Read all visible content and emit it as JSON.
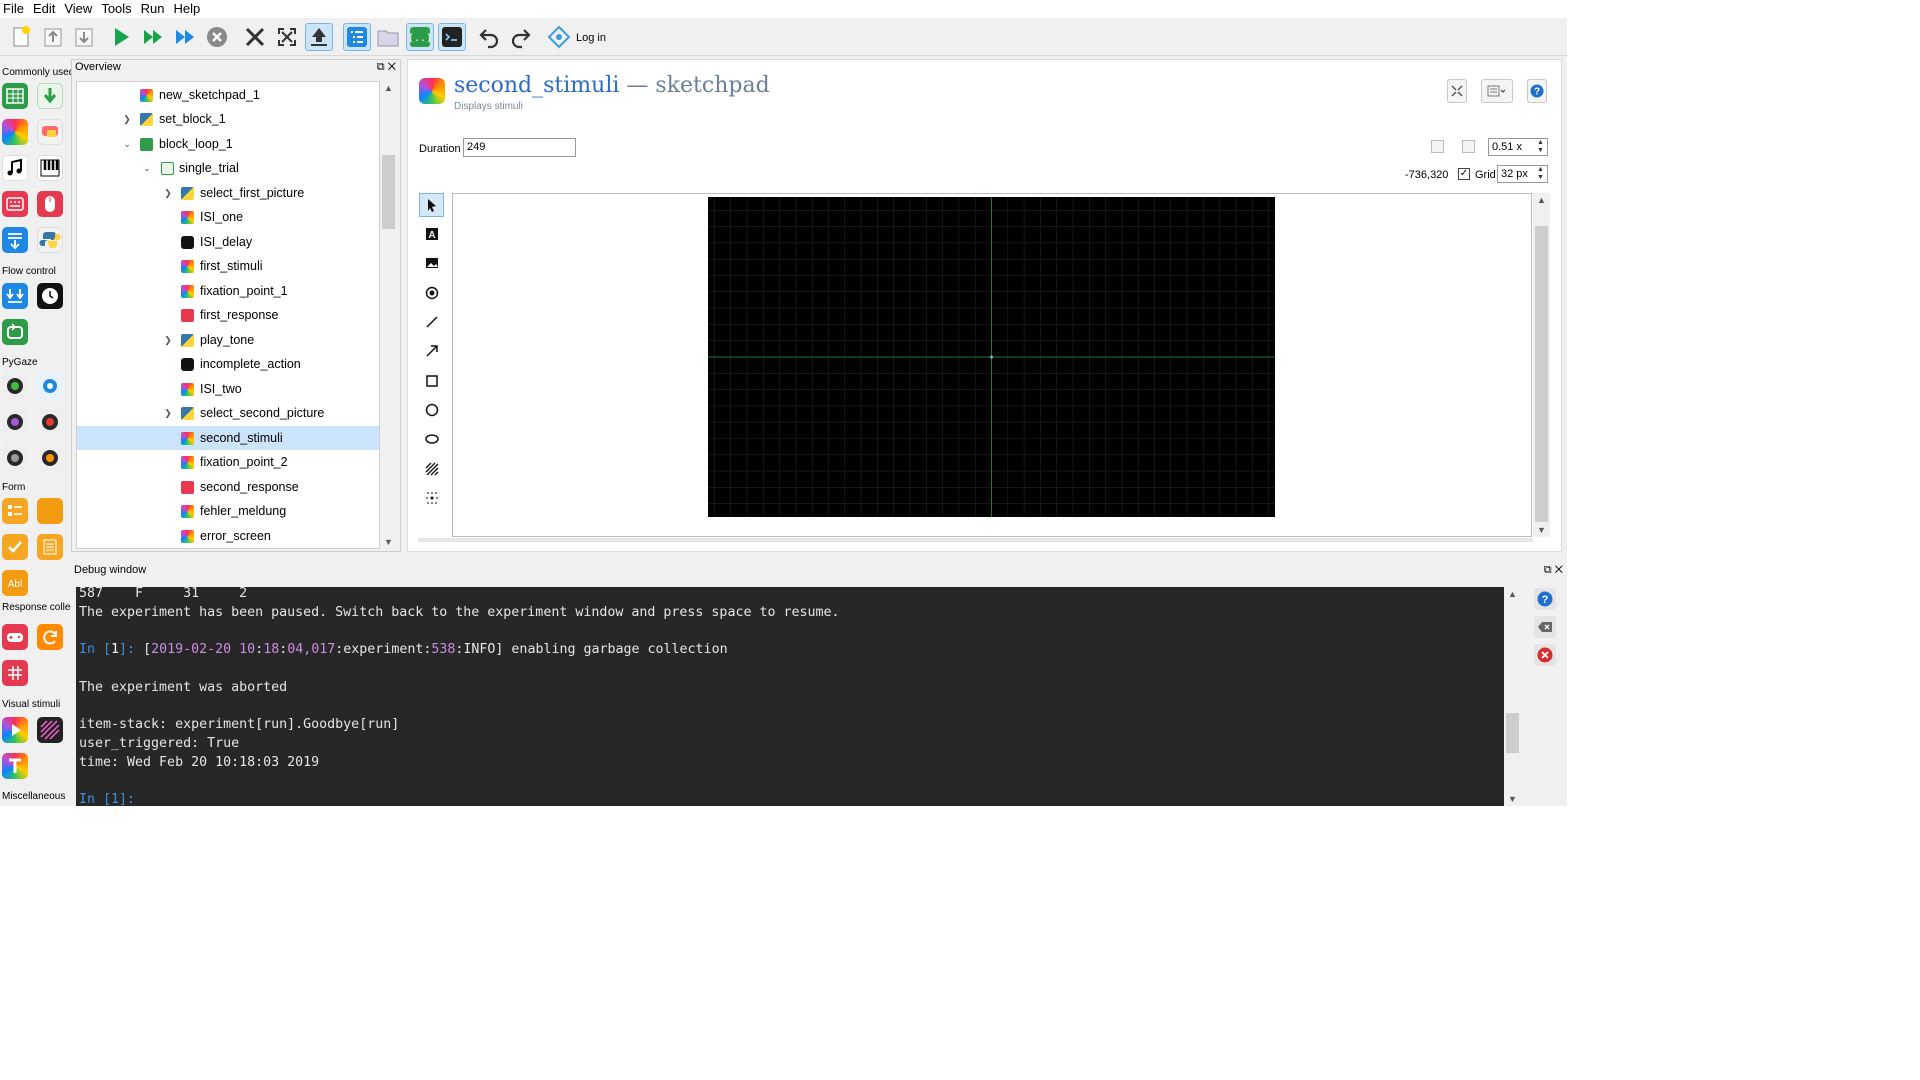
{
  "menu": [
    "File",
    "Edit",
    "View",
    "Tools",
    "Run",
    "Help"
  ],
  "toolbar": {
    "login_label": "Log in",
    "buttons": [
      "new-icon",
      "open-icon",
      "save-icon",
      "run-icon",
      "run-quick-icon",
      "run-in-window-icon",
      "abort-icon",
      "close-all-tabs-icon",
      "fullscreen-icon",
      "one-tab-mode-icon",
      "overview-icon",
      "file-pool-icon",
      "variable-inspector-icon",
      "debug-window-icon",
      "undo-icon",
      "redo-icon",
      "login-icon"
    ]
  },
  "itembar": {
    "categories": [
      "Commonly used",
      "Flow control",
      "PyGaze",
      "Form",
      "Response collection",
      "Visual stimuli",
      "Miscellaneous"
    ]
  },
  "overview": {
    "title": "Overview",
    "items": [
      {
        "label": "new_sketchpad_1",
        "icon": "sketchpad"
      },
      {
        "label": "set_block_1",
        "icon": "inline"
      },
      {
        "label": "block_loop_1",
        "icon": "loop"
      },
      {
        "label": "single_trial",
        "icon": "sequence"
      },
      {
        "label": "select_first_picture",
        "icon": "inline"
      },
      {
        "label": "ISI_one",
        "icon": "sketchpad"
      },
      {
        "label": "ISI_delay",
        "icon": "timer"
      },
      {
        "label": "first_stimuli",
        "icon": "sketchpad"
      },
      {
        "label": "fixation_point_1",
        "icon": "sketchpad"
      },
      {
        "label": "first_response",
        "icon": "keyboard"
      },
      {
        "label": "play_tone",
        "icon": "inline"
      },
      {
        "label": "incomplete_action",
        "icon": "timer"
      },
      {
        "label": "ISI_two",
        "icon": "sketchpad"
      },
      {
        "label": "select_second_picture",
        "icon": "inline"
      },
      {
        "label": "second_stimuli",
        "icon": "sketchpad"
      },
      {
        "label": "fixation_point_2",
        "icon": "sketchpad"
      },
      {
        "label": "second_response",
        "icon": "keyboard"
      },
      {
        "label": "fehler_meldung",
        "icon": "sketchpad"
      },
      {
        "label": "error_screen",
        "icon": "sketchpad"
      }
    ],
    "selected": "second_stimuli"
  },
  "editor": {
    "item_name": "second_stimuli",
    "dash": "—",
    "item_type": "sketchpad",
    "subtitle": "Displays stimuli",
    "duration_label": "Duration",
    "duration_value": "249",
    "zoom_value": "0.51 x",
    "cursor_coords": "-736,320",
    "grid_label": "Grid",
    "grid_checked": "✓",
    "grid_value": "32 px",
    "tools": [
      "select-tool-icon",
      "text-tool-icon",
      "image-tool-icon",
      "gabor-tool-icon",
      "line-tool-icon",
      "arrow-tool-icon",
      "rect-tool-icon",
      "circle-tool-icon",
      "ellipse-tool-icon",
      "noise-patch-tool-icon",
      "fixdot-tool-icon"
    ]
  },
  "debug": {
    "title": "Debug window",
    "lines": {
      "l1": "587    F     31     2",
      "l2": "The experiment has been paused. Switch back to the experiment window and press space to resume.",
      "l3_prompt": "In [",
      "l3_num": "1",
      "l3_close": "]: ",
      "l3_open": "[",
      "l3_date": "2019-02-20",
      "l3_time_a": "10",
      "l3_colon1": ":",
      "l3_time_b": "18",
      "l3_colon2": ":",
      "l3_time_c": "04,017",
      "l3_mod": ":experiment:",
      "l3_line": "538",
      "l3_rest": ":INFO] enabling garbage collection",
      "l4": "The experiment was aborted",
      "l5": "item-stack: experiment[run].Goodbye[run]",
      "l6": "user_triggered: True",
      "l7": "time: Wed Feb 20 10:18:03 2019",
      "l8": "In [1]:"
    }
  }
}
